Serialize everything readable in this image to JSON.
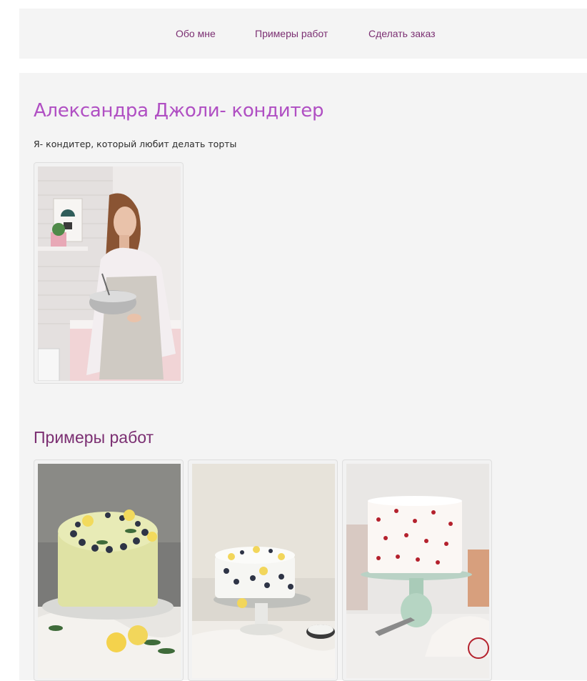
{
  "nav": {
    "items": [
      {
        "label": "Обо мне"
      },
      {
        "label": "Примеры работ"
      },
      {
        "label": "Сделать заказ"
      }
    ]
  },
  "about": {
    "title": "Александра Джоли- кондитер",
    "intro": "Я- кондитер, который любит делать торты",
    "photo_icon": "portrait-photo"
  },
  "works": {
    "title": "Примеры работ",
    "items": [
      {
        "icon": "lemon-blueberry-cake-photo"
      },
      {
        "icon": "lemon-berry-cake-on-stand-photo"
      },
      {
        "icon": "heart-cake-on-stand-photo"
      }
    ]
  },
  "colors": {
    "nav_link": "#7b2f72",
    "heading": "#b04fc3",
    "panel_bg": "#f4f4f4"
  }
}
